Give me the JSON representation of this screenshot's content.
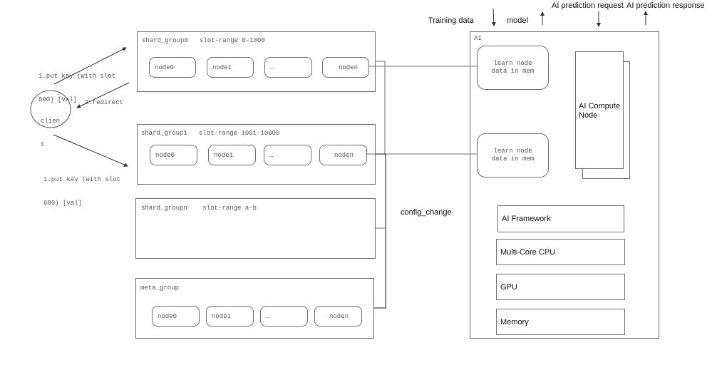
{
  "client": {
    "label_line1": "clien",
    "label_line2": "t",
    "put_label_top_line1": "1.put key (with slot",
    "put_label_top_line2": "600) [val]",
    "redirect_label": "2.redirect",
    "put_label_bottom_line1": "1.put key (with slot",
    "put_label_bottom_line2": "600) [val]"
  },
  "shard_groups": [
    {
      "title": "shard_group0   slot-range 0-1000",
      "nodes": [
        "node0",
        "node1",
        "…",
        "noden"
      ]
    },
    {
      "title": "shard_group1   slot-range 1001-10000",
      "nodes": [
        "node0",
        "node1",
        "…",
        "noden"
      ]
    },
    {
      "title": "shard_groupn    slot-range a-b",
      "nodes": []
    }
  ],
  "meta_group": {
    "title": "meta_group",
    "nodes": [
      "node0",
      "node1",
      "…",
      "noden"
    ]
  },
  "config_change_label": "config_change",
  "ai": {
    "title": "AI",
    "learn_nodes": [
      {
        "line1": "learn node",
        "line2": "data in mem"
      },
      {
        "line1": "learn node",
        "line2": "data in mem"
      }
    ],
    "compute_node": {
      "line1": "AI Compute",
      "line2": "Node"
    },
    "components": [
      "AI Framework",
      "Multi-Core CPU",
      "GPU",
      "Memory"
    ]
  },
  "io_labels": {
    "training_data": "Training data",
    "model": "model",
    "prediction_request": "AI prediction request",
    "prediction_response": "AI prediction response"
  },
  "colors": {
    "stroke": "#6f6f6f",
    "bus": "#111111",
    "text": "#555555"
  }
}
